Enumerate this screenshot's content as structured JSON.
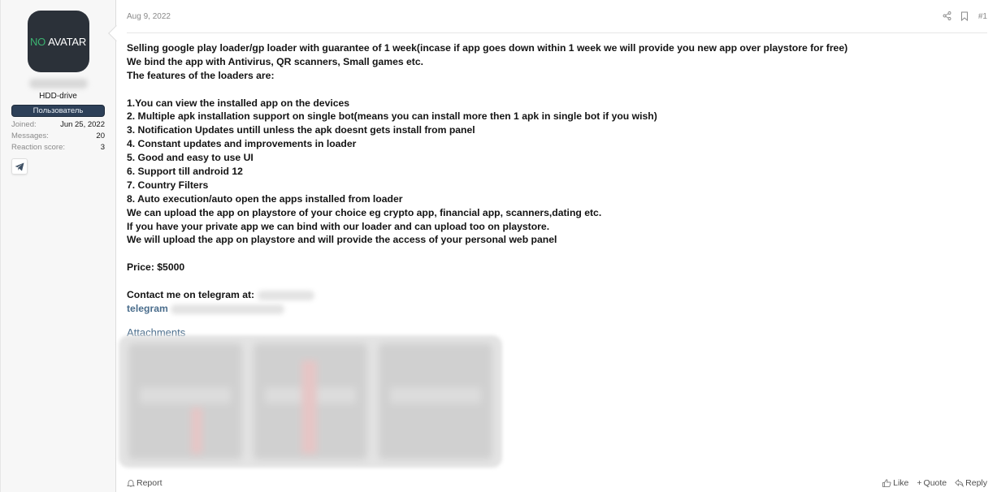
{
  "user": {
    "avatar_text_no": "NO",
    "avatar_text_avatar": "AVATAR",
    "title": "HDD-drive",
    "banner": "Пользователь",
    "extras": [
      {
        "label": "Joined:",
        "value": "Jun 25, 2022"
      },
      {
        "label": "Messages:",
        "value": "20"
      },
      {
        "label": "Reaction score:",
        "value": "3"
      }
    ],
    "contact_icon": "telegram-icon"
  },
  "post": {
    "date": "Aug 9, 2022",
    "number": "#1",
    "header_icons": [
      "share-icon",
      "bookmark-icon"
    ],
    "lines": [
      "Selling google play loader/gp loader with guarantee of 1 week(incase if app goes down within 1 week we will provide you new app over playstore for free)",
      "We bind the app with Antivirus, QR scanners, Small games etc.",
      "The features of the loaders are:",
      "",
      "1.You can view the installed app on the devices",
      "2. Multiple apk installation support on single bot(means you can install more then 1 apk in single bot if you wish)",
      "3. Notification Updates untill unless the apk doesnt gets install from panel",
      "4. Constant updates and improvements in loader",
      "5. Good and easy to use UI",
      "6. Support till android 12",
      "7. Country Filters",
      "8. Auto execution/auto open the apps installed from loader",
      "We can upload the app on playstore of your choice eg crypto app, financial app, scanners,dating etc.",
      "If you have your private app we can bind with our loader and can upload too on playstore.",
      "We will upload the app on playstore and will provide the access of your personal web panel",
      "",
      "Price: $5000",
      ""
    ],
    "contact_label": "Contact me on telegram at:",
    "telegram_link": "telegram",
    "attachments_title": "Attachments",
    "attachments_count": 3
  },
  "footer": {
    "report": "Report",
    "like": "Like",
    "quote": "Quote",
    "reply": "Reply"
  }
}
